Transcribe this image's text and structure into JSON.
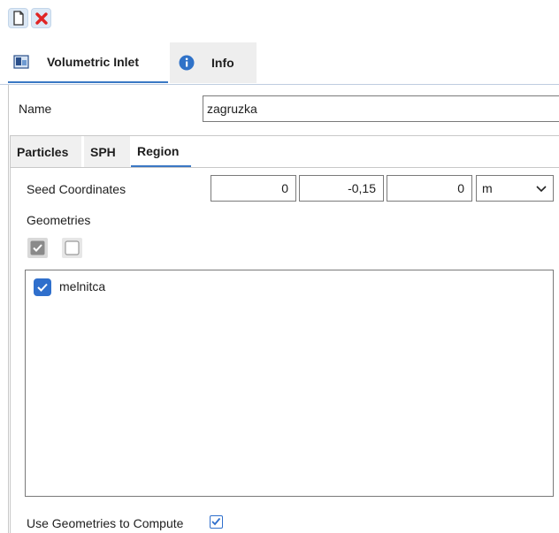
{
  "toolbar": {
    "new_icon": "document-icon",
    "delete_icon": "red-x-icon"
  },
  "tabs": [
    {
      "label": "Volumetric Inlet",
      "icon": "inlet-icon",
      "active": true
    },
    {
      "label": "Info",
      "icon": "info-icon",
      "active": false
    }
  ],
  "name": {
    "label": "Name",
    "value": "zagruzka"
  },
  "sub_tabs": [
    {
      "label": "Particles",
      "active": false
    },
    {
      "label": "SPH",
      "active": false
    },
    {
      "label": "Region",
      "active": true
    }
  ],
  "seed": {
    "label": "Seed Coordinates",
    "x": "0",
    "y": "-0,15",
    "z": "0",
    "unit": "m"
  },
  "geometries": {
    "label": "Geometries",
    "items": [
      {
        "name": "melnitca",
        "checked": true
      }
    ]
  },
  "use_geometries": {
    "label": "Use Geometries to Compute",
    "checked": true
  },
  "colors": {
    "accent": "#3a78c4",
    "checkbox": "#2f6fcc",
    "delete": "#e02424"
  }
}
